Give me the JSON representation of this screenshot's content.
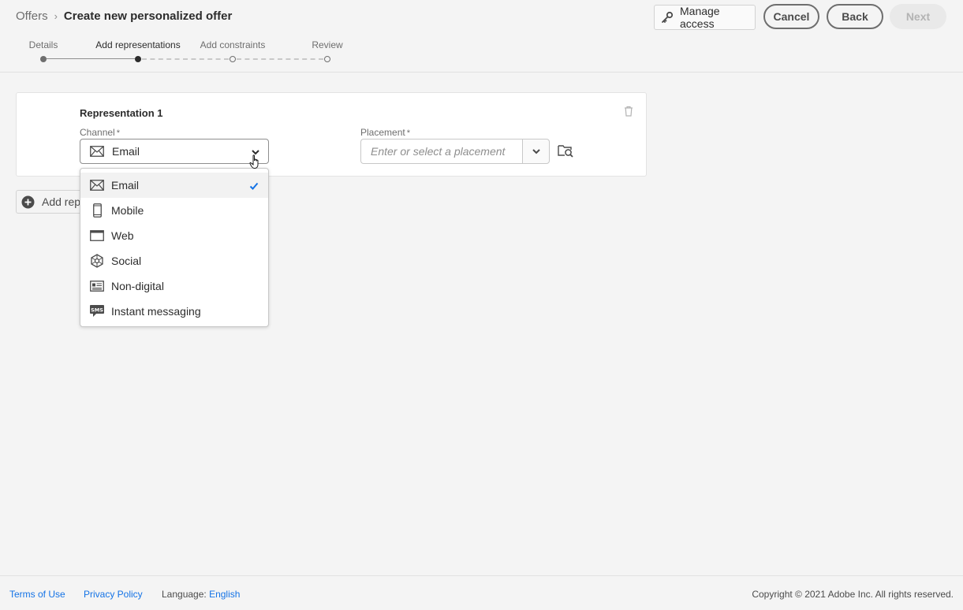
{
  "header": {
    "breadcrumb_parent": "Offers",
    "breadcrumb_separator": "›",
    "page_title": "Create new personalized offer",
    "manage_access_label": "Manage access",
    "cancel_label": "Cancel",
    "back_label": "Back",
    "next_label": "Next"
  },
  "stepper": {
    "steps": [
      {
        "label": "Details",
        "state": "done"
      },
      {
        "label": "Add representations",
        "state": "current"
      },
      {
        "label": "Add constraints",
        "state": "todo"
      },
      {
        "label": "Review",
        "state": "todo"
      }
    ]
  },
  "representation": {
    "title": "Representation 1",
    "channel_label": "Channel",
    "required_mark": "*",
    "channel_value": "Email",
    "placement_label": "Placement",
    "placement_placeholder": "Enter or select a placement"
  },
  "add_representation_label": "Add representation",
  "channel_dropdown": {
    "options": [
      {
        "label": "Email",
        "icon": "mail-icon",
        "selected": true
      },
      {
        "label": "Mobile",
        "icon": "mobile-icon",
        "selected": false
      },
      {
        "label": "Web",
        "icon": "web-icon",
        "selected": false
      },
      {
        "label": "Social",
        "icon": "social-icon",
        "selected": false
      },
      {
        "label": "Non-digital",
        "icon": "non-digital-icon",
        "selected": false
      },
      {
        "label": "Instant messaging",
        "icon": "sms-icon",
        "selected": false
      }
    ],
    "sms_badge": "SMS"
  },
  "footer": {
    "terms": "Terms of Use",
    "privacy": "Privacy Policy",
    "language_label": "Language:",
    "language_value": "English",
    "copyright": "Copyright ©  2021 Adobe Inc.  All rights reserved."
  },
  "colors": {
    "link": "#1473e6",
    "check": "#1473e6",
    "background": "#f4f4f4"
  }
}
